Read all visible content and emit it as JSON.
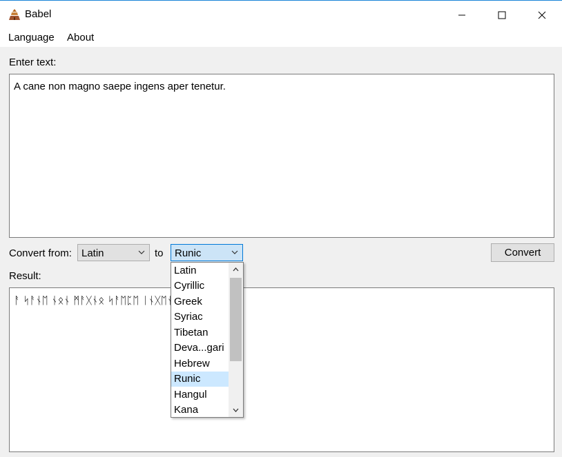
{
  "window": {
    "title": "Babel",
    "icons": {
      "app": "babel-tower-icon",
      "minimize": "minimize-icon",
      "maximize": "maximize-icon",
      "close": "close-icon"
    }
  },
  "menu": {
    "items": [
      "Language",
      "About"
    ]
  },
  "input": {
    "label": "Enter text:",
    "value": "A cane non magno saepe ingens aper tenetur."
  },
  "convert": {
    "from_label": "Convert from:",
    "from_value": "Latin",
    "to_label": "to",
    "to_value": "Runic",
    "button_label": "Convert"
  },
  "dropdown": {
    "options": [
      "Latin",
      "Cyrillic",
      "Greek",
      "Syriac",
      "Tibetan",
      "Deva...gari",
      "Hebrew",
      "Runic",
      "Hangul",
      "Kana"
    ],
    "selected": "Runic"
  },
  "result": {
    "label": "Result:",
    "value": "ᚨ ᛋᚨᚾᛖ ᚾᛟᚾ ᛗᚨᚷᚾᛟ ᛋᚨᛖᛈᛖ ᛁᚾᚷᛖᚾᛋ ᚨᛈᛖ"
  },
  "colors": {
    "accent": "#0078d7",
    "selection": "#cce8ff",
    "window_border": "#1883d7"
  }
}
